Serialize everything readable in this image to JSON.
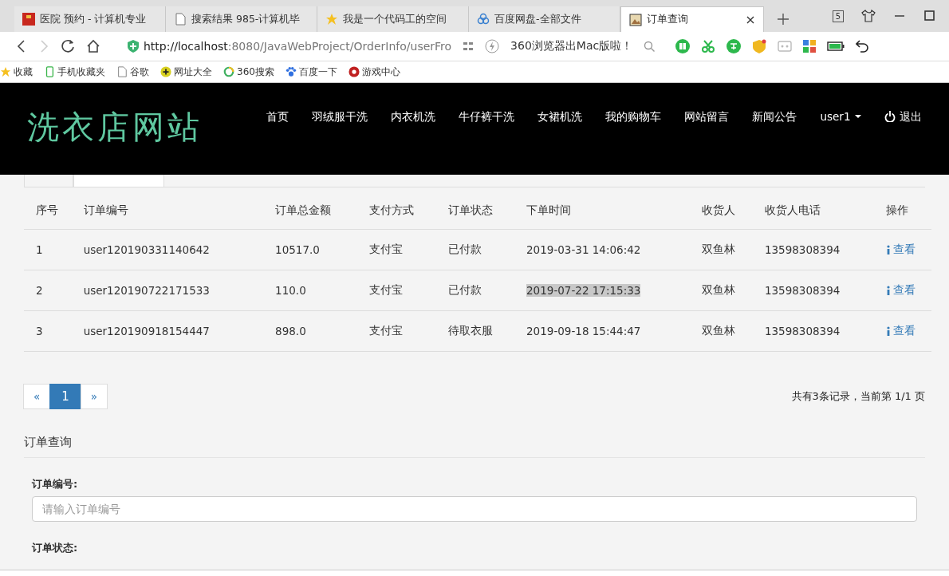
{
  "browser": {
    "tabs": [
      {
        "label": "医院 预约 - 计算机专业",
        "selected": false
      },
      {
        "label": "搜索结果 985-计算机毕",
        "selected": false
      },
      {
        "label": "我是一个代码工的空间",
        "selected": false
      },
      {
        "label": "百度网盘-全部文件",
        "selected": false
      },
      {
        "label": "订单查询",
        "selected": true
      }
    ],
    "tab_count": "5",
    "url_host": "http://localhost",
    "url_rest": ":8080/JavaWebProject/OrderInfo/userFro",
    "search_hint": "360浏览器出Mac版啦！",
    "bookmarks": [
      {
        "label": "收藏"
      },
      {
        "label": "手机收藏夹"
      },
      {
        "label": "谷歌"
      },
      {
        "label": "网址大全"
      },
      {
        "label": "360搜索"
      },
      {
        "label": "百度一下"
      },
      {
        "label": "游戏中心"
      }
    ]
  },
  "site": {
    "logo": "洗衣店网站",
    "nav": [
      "首页",
      "羽绒服干洗",
      "内衣机洗",
      "牛仔裤干洗",
      "女裙机洗",
      "我的购物车",
      "网站留言",
      "新闻公告"
    ],
    "user": "user1",
    "logout": "退出"
  },
  "table": {
    "columns": [
      "序号",
      "订单编号",
      "订单总金额",
      "支付方式",
      "订单状态",
      "下单时间",
      "收货人",
      "收货人电话",
      "操作"
    ],
    "rows": [
      {
        "cells": [
          "1",
          "user120190331140642",
          "10517.0",
          "支付宝",
          "已付款",
          "2019-03-31 14:06:42",
          "双鱼林",
          "13598308394"
        ],
        "action": "查看",
        "time_selected": false
      },
      {
        "cells": [
          "2",
          "user120190722171533",
          "110.0",
          "支付宝",
          "已付款",
          "2019-07-22 17:15:33",
          "双鱼林",
          "13598308394"
        ],
        "action": "查看",
        "time_selected": true
      },
      {
        "cells": [
          "3",
          "user120190918154447",
          "898.0",
          "支付宝",
          "待取衣服",
          "2019-09-18 15:44:47",
          "双鱼林",
          "13598308394"
        ],
        "action": "查看",
        "time_selected": false
      }
    ]
  },
  "pager": {
    "prev": "«",
    "pages": [
      {
        "label": "1",
        "selected": true
      }
    ],
    "next": "»",
    "summary": "共有3条记录，当前第 1/1 页"
  },
  "query": {
    "title": "订单查询",
    "fields": [
      {
        "label": "订单编号:",
        "placeholder": "请输入订单编号"
      },
      {
        "label": "订单状态:"
      }
    ]
  }
}
